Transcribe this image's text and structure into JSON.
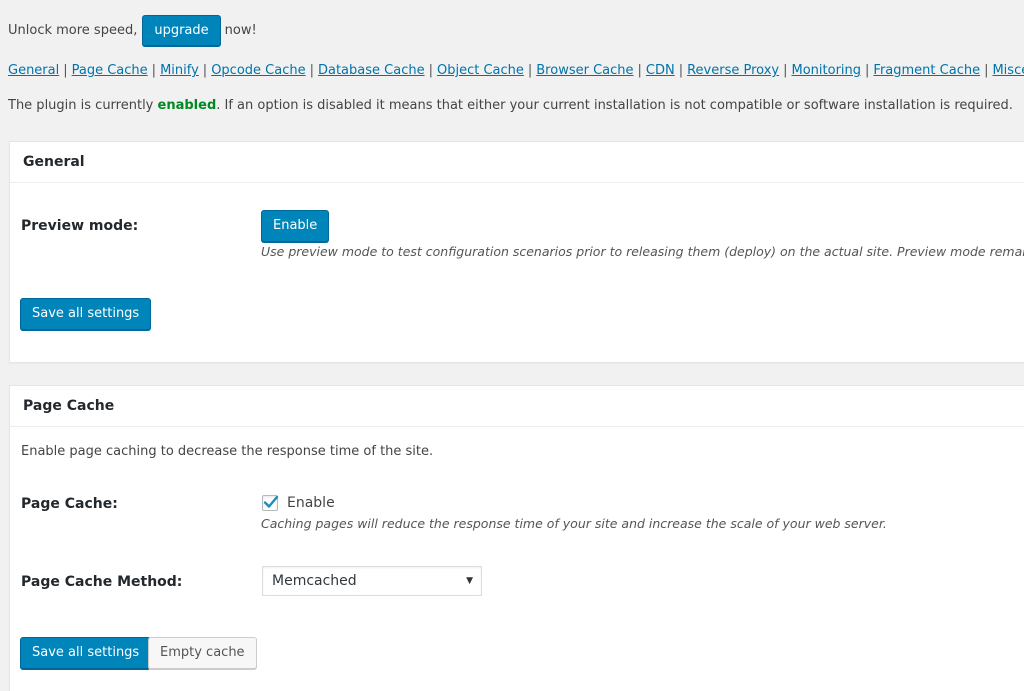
{
  "upgrade_banner": {
    "prefix": "Unlock more speed,",
    "button": "upgrade",
    "suffix": "now!"
  },
  "nav": {
    "links": [
      "General",
      "Page Cache",
      "Minify",
      "Opcode Cache",
      "Database Cache",
      "Object Cache",
      "Browser Cache",
      "CDN",
      "Reverse Proxy",
      "Monitoring",
      "Fragment Cache",
      "Miscellaneo"
    ]
  },
  "status": {
    "prefix": "The plugin is currently",
    "state": "enabled",
    "suffix": ". If an option is disabled it means that either your current installation is not compatible or software installation is required."
  },
  "general_box": {
    "title": "General",
    "preview_label": "Preview mode:",
    "preview_button": "Enable",
    "preview_desc": "Use preview mode to test configuration scenarios prior to releasing them (deploy) on the actual site. Preview mode remains a",
    "save_button": "Save all settings"
  },
  "page_cache_box": {
    "title": "Page Cache",
    "intro": "Enable page caching to decrease the response time of the site.",
    "page_cache_label": "Page Cache:",
    "enable_label": "Enable",
    "enable_checked": true,
    "enable_desc": "Caching pages will reduce the response time of your site and increase the scale of your web server.",
    "method_label": "Page Cache Method:",
    "method_value": "Memcached",
    "save_button": "Save all settings",
    "empty_button": "Empty cache"
  },
  "icons": {
    "checkmark": "check-icon",
    "dropdown": "caret-down-icon"
  },
  "colors": {
    "primary": "#0085ba",
    "link": "#0073aa",
    "enabled": "#008a20"
  }
}
